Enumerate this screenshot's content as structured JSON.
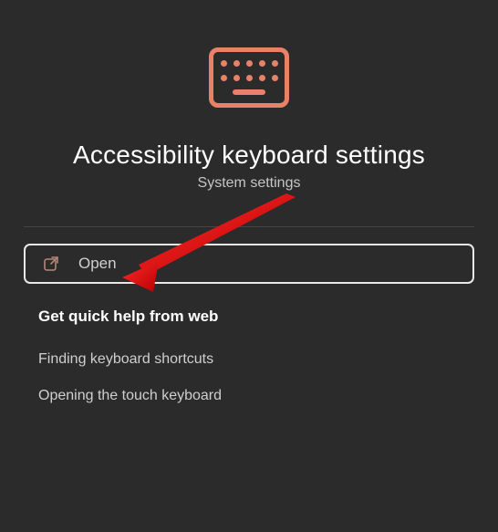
{
  "hero": {
    "title": "Accessibility keyboard settings",
    "subtitle": "System settings",
    "icon_name": "keyboard-icon"
  },
  "actions": {
    "open_label": "Open"
  },
  "help": {
    "heading": "Get quick help from web",
    "links": [
      {
        "label": "Finding keyboard shortcuts"
      },
      {
        "label": "Opening the touch keyboard"
      }
    ]
  },
  "colors": {
    "accent": "#e88168",
    "bg": "#2b2b2b",
    "annotation": "#de1b1b"
  }
}
